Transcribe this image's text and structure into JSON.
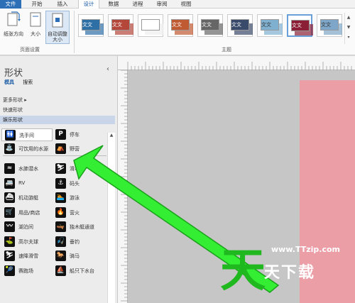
{
  "menu": {
    "tabs": [
      {
        "label": "文件"
      },
      {
        "label": "开始"
      },
      {
        "label": "插入"
      },
      {
        "label": "设计"
      },
      {
        "label": "数据"
      },
      {
        "label": "进程"
      },
      {
        "label": "审阅"
      },
      {
        "label": "视图"
      }
    ],
    "active": "设计"
  },
  "ribbon": {
    "page_setup": {
      "orientation_label": "纸张方向",
      "size_label": "大小",
      "autofit_label": "自动调整大小",
      "group_label": "页面设置"
    },
    "themes": {
      "group_label": "主题",
      "swatch_text": "文文",
      "colors": [
        "#2e6fa6",
        "#b4473a",
        "#ffffff",
        "#c05a33",
        "#666666",
        "#3a4a6a",
        "#7fb0d0",
        "#8a1f36",
        "#7ea6c8"
      ]
    }
  },
  "panel": {
    "title": "形状",
    "tabs": [
      "模具",
      "搜索"
    ],
    "menu": [
      "更多形状",
      "快速形状",
      "娱乐形状"
    ],
    "selected_stencil": "娱乐形状",
    "shapes": [
      {
        "icon": "restroom-icon",
        "glyph": "🚻",
        "label": "洗手间"
      },
      {
        "icon": "parking-icon",
        "glyph": "P",
        "label": "停车"
      },
      {
        "icon": "drinking-water-icon",
        "glyph": "⛲",
        "label": "可饮用的水源"
      },
      {
        "icon": "camping-icon",
        "glyph": "⛺",
        "label": "野营"
      },
      {
        "icon": "scuba-icon",
        "glyph": "≈",
        "label": "水肺潜水"
      },
      {
        "icon": "skiing-icon",
        "glyph": "⛷",
        "label": "滑冰"
      },
      {
        "icon": "rv-icon",
        "glyph": "🚐",
        "label": "RV"
      },
      {
        "icon": "dock-icon",
        "glyph": "⚓",
        "label": "码头"
      },
      {
        "icon": "motorboat-icon",
        "glyph": "⛴",
        "label": "机动游艇"
      },
      {
        "icon": "swimming-icon",
        "glyph": "🏊",
        "label": "游泳"
      },
      {
        "icon": "store-icon",
        "glyph": "🛒",
        "label": "用品/商店"
      },
      {
        "icon": "campfire-icon",
        "glyph": "🔥",
        "label": "营火"
      },
      {
        "icon": "lake-icon",
        "glyph": "〰",
        "label": "湖泊间"
      },
      {
        "icon": "canoe-icon",
        "glyph": "🛶",
        "label": "独木艇通道"
      },
      {
        "icon": "golf-icon",
        "glyph": "⛳",
        "label": "高尔夫球"
      },
      {
        "icon": "fishing-icon",
        "glyph": "🎣",
        "label": "垂钓"
      },
      {
        "icon": "downhill-ski-icon",
        "glyph": "⛷",
        "label": "速降滑雪"
      },
      {
        "icon": "horse-icon",
        "glyph": "🐎",
        "label": "骑马"
      },
      {
        "icon": "tennis-icon",
        "glyph": "🎾",
        "label": "赛跑场"
      },
      {
        "icon": "boat-launch-icon",
        "glyph": "⛵",
        "label": "船只下水台"
      }
    ]
  },
  "watermark": {
    "big": "天",
    "url": "www.TTzip.com",
    "name": "天下载"
  },
  "colors": {
    "accent": "#2d6fb7",
    "arrow": "#2ee62e",
    "page": "#ec9ea7",
    "canvas": "#c6c6c6"
  }
}
